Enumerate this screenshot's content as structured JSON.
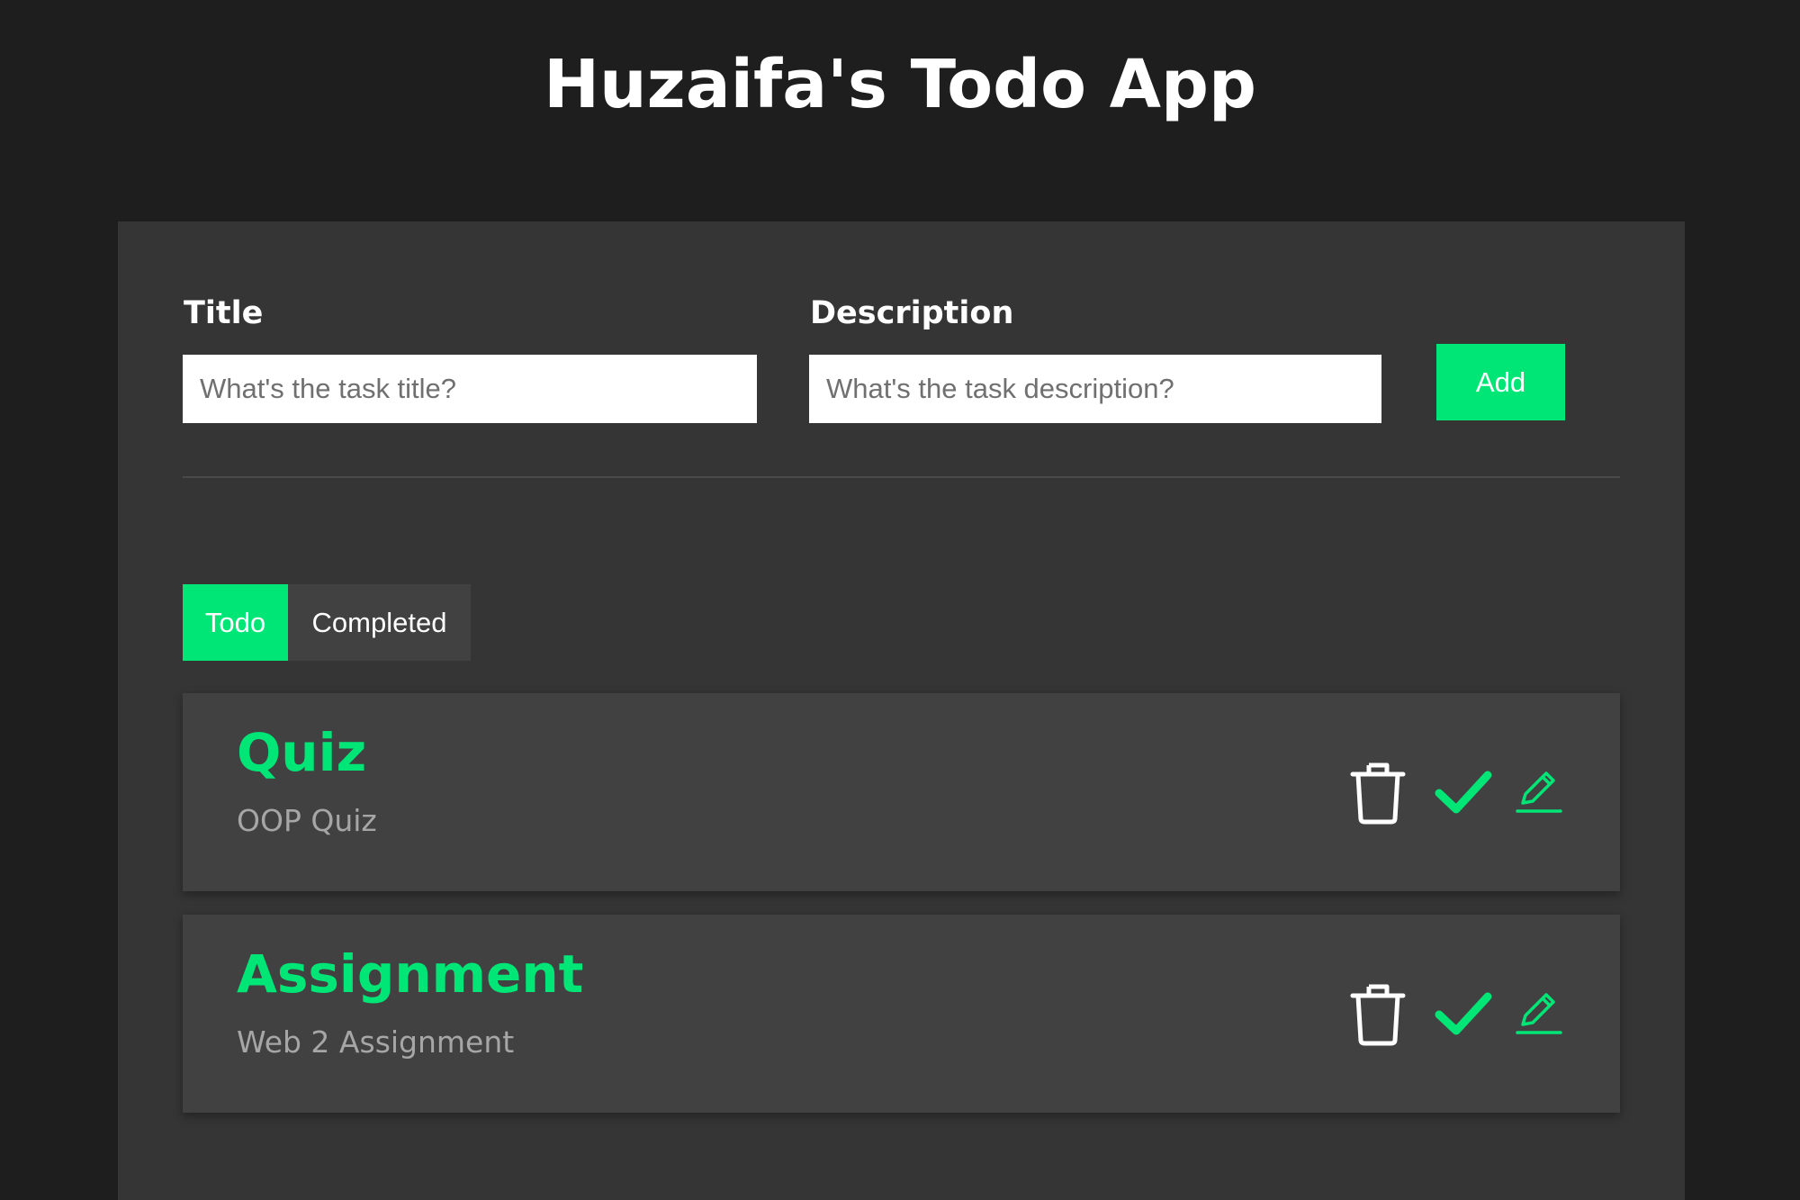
{
  "app": {
    "title": "Huzaifa's Todo App"
  },
  "form": {
    "title_label": "Title",
    "title_placeholder": "What's the task title?",
    "title_value": "",
    "description_label": "Description",
    "description_placeholder": "What's the task description?",
    "description_value": "",
    "add_label": "Add"
  },
  "tabs": [
    {
      "label": "Todo",
      "active": true
    },
    {
      "label": "Completed",
      "active": false
    }
  ],
  "todos": [
    {
      "title": "Quiz",
      "description": "OOP Quiz"
    },
    {
      "title": "Assignment",
      "description": "Web 2 Assignment"
    }
  ],
  "icons": {
    "delete": "trash-icon",
    "complete": "check-icon",
    "edit": "pencil-icon"
  },
  "colors": {
    "accent": "#00e676",
    "background": "#1e1e1e",
    "card": "#353535",
    "item": "#414141",
    "description_text": "#a6a6a6"
  }
}
